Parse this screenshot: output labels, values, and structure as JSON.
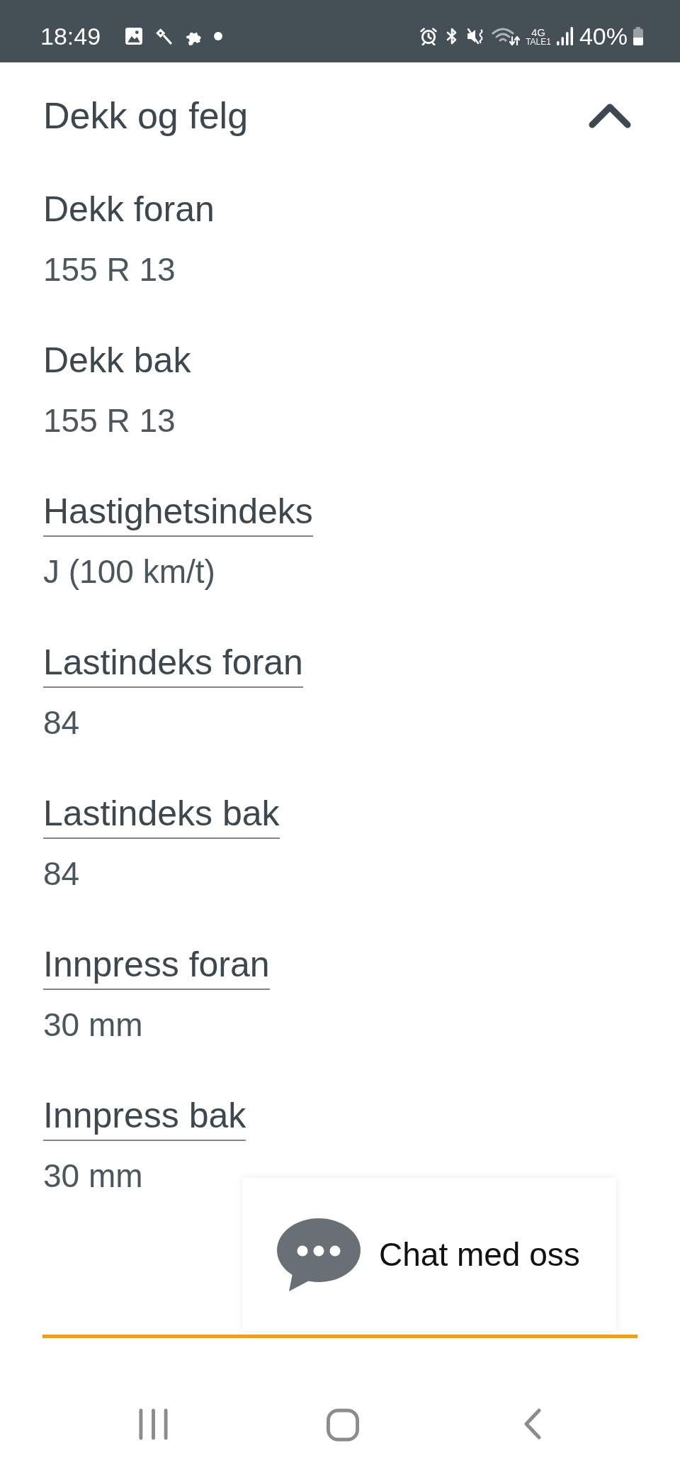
{
  "status_bar": {
    "time": "18:49",
    "network": "4G",
    "carrier": "TALE1",
    "battery": "40%"
  },
  "section": {
    "title": "Dekk og felg",
    "expanded": true,
    "fields": [
      {
        "label": "Dekk foran",
        "value": "155 R 13",
        "underlined": false
      },
      {
        "label": "Dekk bak",
        "value": "155 R 13",
        "underlined": false
      },
      {
        "label": "Hastighetsindeks",
        "value": "J (100 km/t)",
        "underlined": true
      },
      {
        "label": "Lastindeks foran",
        "value": "84",
        "underlined": true
      },
      {
        "label": "Lastindeks bak",
        "value": "84",
        "underlined": true
      },
      {
        "label": "Innpress foran",
        "value": "30 mm",
        "underlined": true
      },
      {
        "label": "Innpress bak",
        "value": "30 mm",
        "underlined": true
      }
    ]
  },
  "chat_button": {
    "label": "Chat med oss"
  }
}
